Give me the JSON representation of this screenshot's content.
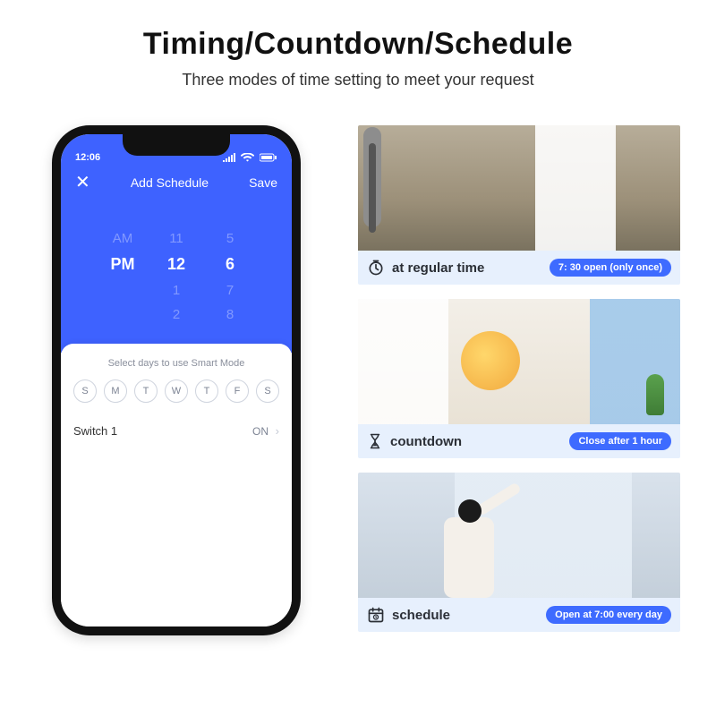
{
  "header": {
    "title": "Timing/Countdown/Schedule",
    "subtitle": "Three modes of time setting to meet your request"
  },
  "phone": {
    "status": {
      "time": "12:06"
    },
    "nav": {
      "close": "✕",
      "title": "Add Schedule",
      "save": "Save"
    },
    "picker": {
      "ampm": {
        "prev": "AM",
        "cur": "PM",
        "next": ""
      },
      "hour": {
        "prev": "11",
        "cur": "12",
        "next1": "1",
        "next2": "2"
      },
      "min": {
        "prev": "5",
        "cur": "6",
        "next1": "7",
        "next2": "8"
      }
    },
    "sheet": {
      "hint": "Select days to use Smart Mode",
      "days": [
        "S",
        "M",
        "T",
        "W",
        "T",
        "F",
        "S"
      ],
      "switch": {
        "label": "Switch 1",
        "value": "ON"
      }
    }
  },
  "cards": [
    {
      "icon": "clock",
      "label": "at regular time",
      "pill": "7: 30 open (only once)"
    },
    {
      "icon": "hourglass",
      "label": "countdown",
      "pill": "Close after 1 hour"
    },
    {
      "icon": "calendar",
      "label": "schedule",
      "pill": "Open at 7:00 every day"
    }
  ]
}
